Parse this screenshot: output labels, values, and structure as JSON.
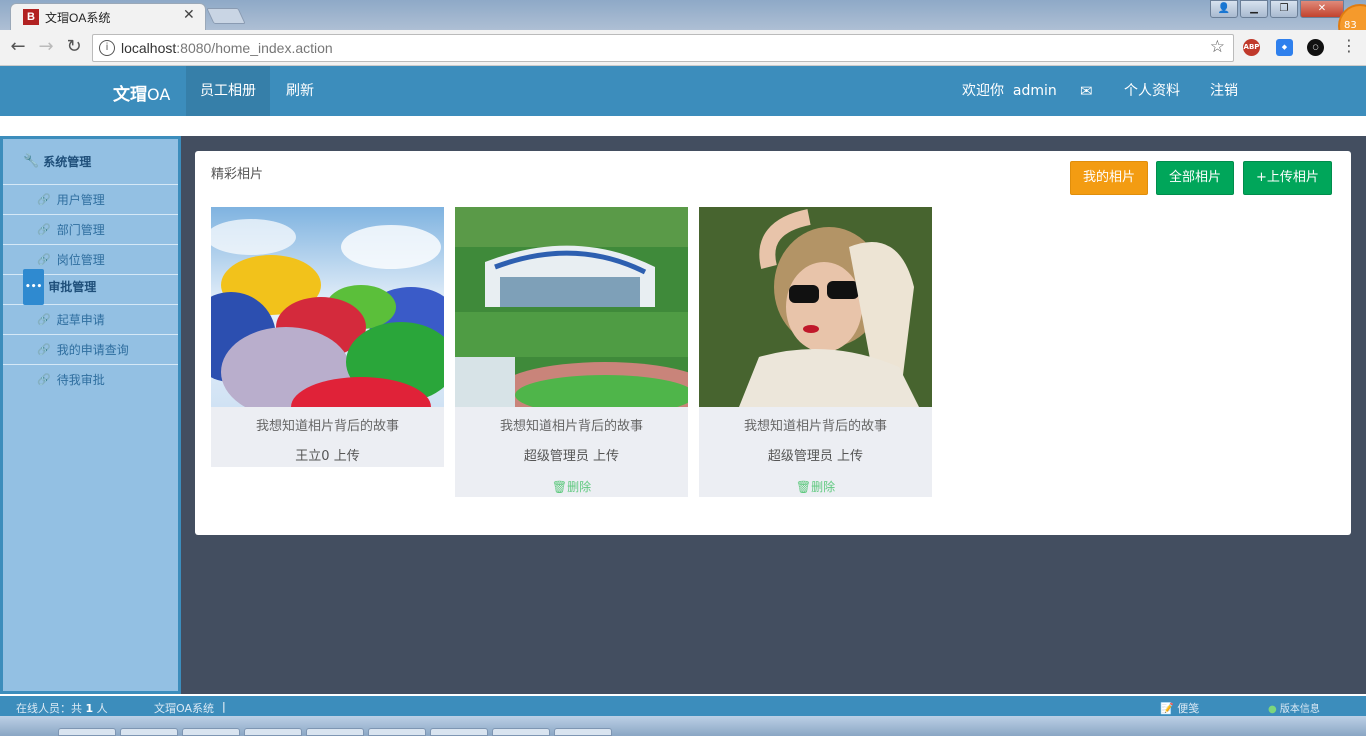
{
  "browser": {
    "tab_title": "文瑁OA系统",
    "tab_favicon": "B",
    "url_host": "localhost",
    "url_rest": ":8080/home_index.action",
    "extension_badge": "83"
  },
  "navbar": {
    "brand_bold": "文瑁",
    "brand_light": "OA",
    "items": [
      "员工相册",
      "刷新"
    ],
    "welcome": "欢迎你",
    "username": "admin",
    "profile": "个人资料",
    "logout": "注销"
  },
  "sidebar": {
    "group1": "系统管理",
    "group1_items": [
      "用户管理",
      "部门管理",
      "岗位管理"
    ],
    "group2": "审批管理",
    "group2_items": [
      "起草申请",
      "我的申请查询",
      "待我审批"
    ]
  },
  "panel": {
    "title": "精彩相片",
    "btn_my": "我的相片",
    "btn_all": "全部相片",
    "btn_upload": "+上传相片",
    "cards": [
      {
        "caption": "我想知道相片背后的故事",
        "uploader": "王立0 上传",
        "delete": ""
      },
      {
        "caption": "我想知道相片背后的故事",
        "uploader": "超级管理员 上传",
        "delete": "删除"
      },
      {
        "caption": "我想知道相片背后的故事",
        "uploader": "超级管理员 上传",
        "delete": "删除"
      }
    ]
  },
  "statusbar": {
    "online_label": "在线人员：共",
    "online_count": "1",
    "online_unit": "人",
    "system_name": "文瑁OA系统",
    "notes": "便笺",
    "version": "版本信息"
  }
}
